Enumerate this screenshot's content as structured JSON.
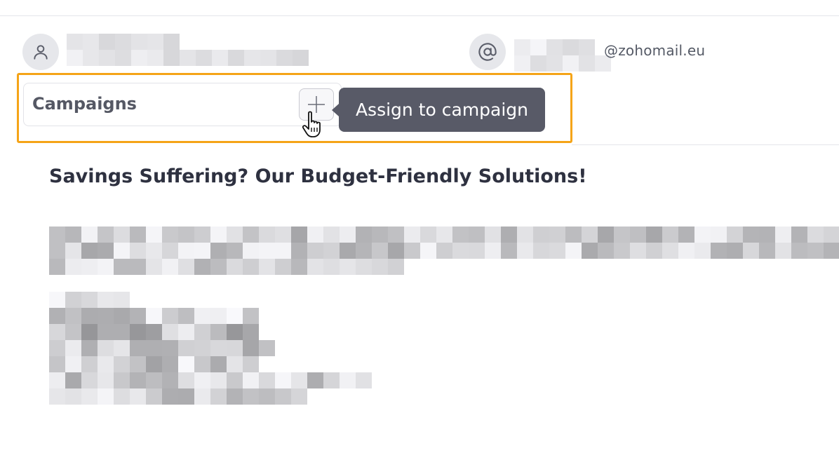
{
  "sender": {
    "avatar_icon": "user-icon",
    "name_redacted": true
  },
  "recipient": {
    "icon": "at-sign-icon",
    "email_domain": "@zohomail.eu"
  },
  "campaigns": {
    "label": "Campaigns",
    "add_icon": "plus-icon",
    "tooltip": "Assign to campaign",
    "cursor": "hand-pointer-icon"
  },
  "message": {
    "subject": "Savings Suffering? Our Budget-Friendly Solutions!",
    "body_redacted": true
  },
  "colors": {
    "highlight": "#f5a418",
    "tooltip_bg": "#585a67",
    "icon_bg": "#e6e7eb"
  }
}
